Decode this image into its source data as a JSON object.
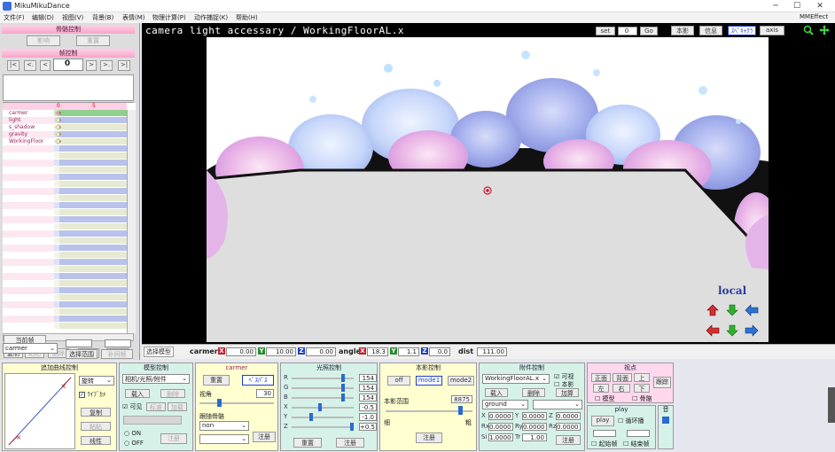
{
  "window": {
    "title": "MikuMikuDance",
    "minimize": "─",
    "maximize": "☐",
    "close": "✕"
  },
  "menu": [
    "文件(F)",
    "编辑(D)",
    "视图(V)",
    "背景(B)",
    "表情(M)",
    "物理计算(P)",
    "动作捕捉(K)",
    "帮助(H)"
  ],
  "menu_right": "MMEffect",
  "left": {
    "bone_ctrl": "骨骼控制",
    "bone_btn1": "影响",
    "bone_btn2": "重置",
    "frame_ctrl": "帧控制",
    "frame_value": "0",
    "nav": [
      "|<",
      "<.",
      "<",
      "0",
      ">",
      ">.",
      ">|"
    ],
    "timeline_header": {
      "col0": "0",
      "col5": "5"
    },
    "tracks": [
      "carmer",
      "light",
      "s_shadow",
      "gravity",
      "WorkingFloor"
    ],
    "cur_pos": "当前帧",
    "row1": [
      "复制",
      "粘贴",
      "删除",
      "选择",
      "删除"
    ],
    "select_value": "carmer",
    "range_btn": "选择范围",
    "range_btn2": "补间帧"
  },
  "viewport": {
    "title": "camera light accessary / WorkingFloorAL.x",
    "set": "set",
    "set_value": "0",
    "go": "Go",
    "btn_shadow": "本影",
    "btn_info": "信息",
    "btn_full": "ｽﾍﾟｷｬｸﾗ",
    "btn_axis": "axis",
    "local": "local"
  },
  "bottombar": {
    "select_model": "选择模型",
    "carmer": "carmer",
    "X": "0.00",
    "Y": "10.00",
    "Z": "0.00",
    "angle": "angle",
    "aX": "18.3",
    "aY": "1.1",
    "aZ": "0.0",
    "dist": "dist",
    "dist_v": "111.00"
  },
  "panels": {
    "interp": {
      "title": "追加曲线控制",
      "rotate": "旋转",
      "check": "ﾗｲﾌﾞｶﾒ",
      "copy": "复制",
      "paste": "粘贴",
      "linear": "线性"
    },
    "model": {
      "title": "模型控制",
      "sel": "相机/光照/附件",
      "load": "载入",
      "del": "删除",
      "visible": "可见",
      "sel1": "标准",
      "sel2": "加载",
      "on": "ON",
      "off": "OFF",
      "reg": "注册"
    },
    "camera": {
      "title": "carmer",
      "reset": "重置",
      "persp": "ﾍﾟｽﾊﾟｽ",
      "angle_lbl": "视角",
      "angle_val": "30",
      "follow": "跟随骨骼",
      "follow_val": "non",
      "reg": "注册"
    },
    "light": {
      "title": "光照控制",
      "R": "154",
      "G": "154",
      "B": "154",
      "X": "-0.5",
      "Y": "-1.0",
      "Z": "+0.5",
      "reset": "重置",
      "reg": "注册"
    },
    "shadow": {
      "title": "本影控制",
      "off": "off",
      "mode1": "mode1",
      "mode2": "mode2",
      "range": "本影范围",
      "range_val": "8875",
      "near": "细",
      "far": "粗",
      "reg": "注册"
    },
    "acc": {
      "title": "附件控制",
      "sel": "WorkingFloorAL.x",
      "visible": "可视",
      "shadow": "本影",
      "load": "载入",
      "del": "删除",
      "add": "加算",
      "ground": "ground",
      "X": "0.0000",
      "Y": "0.0000",
      "Z": "0.0000",
      "Rx": "0.0000",
      "Ry": "0.0000",
      "Rz": "0.0000",
      "Si": "1.0000",
      "Tr": "1.00",
      "reg": "注册"
    },
    "view": {
      "title": "视点",
      "front": "正面",
      "back": "背面",
      "top": "上",
      "left": "左",
      "right": "右",
      "bottom": "下",
      "follow": "跟踪",
      "model": "模型",
      "bone": "骨骼"
    },
    "play": {
      "title": "play",
      "play": "play",
      "loop": "循环播",
      "start": "起始帧",
      "end": "结束帧",
      "vol": "音"
    }
  },
  "colors": {
    "pink": "#f6a6ca",
    "accent": "#3a6ed8"
  }
}
